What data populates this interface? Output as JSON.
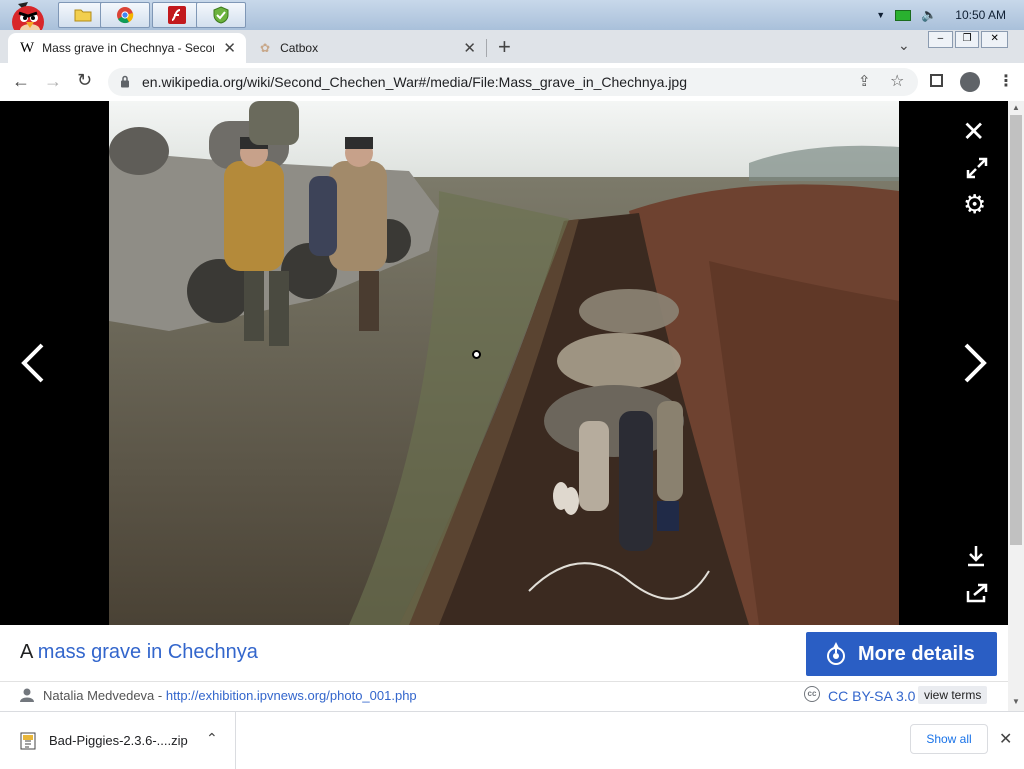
{
  "taskbar": {
    "time": "10:50 AM",
    "apps": [
      "folder-icon",
      "chrome-icon",
      "flash-icon",
      "shield-icon"
    ]
  },
  "browser": {
    "tabs": [
      {
        "label": "Mass grave in Chechnya - Secon",
        "favicon": "W",
        "active": true
      },
      {
        "label": "Catbox",
        "active": false
      }
    ],
    "url": "en.wikipedia.org/wiki/Second_Chechen_War#/media/File:Mass_grave_in_Chechnya.jpg"
  },
  "viewer": {
    "caption_prefix": "A ",
    "caption_link": "mass grave in Chechnya",
    "more_details_label": "More details",
    "author": "Natalia Medvedeva",
    "author_sep": " - ",
    "source_url": "http://exhibition.ipvnews.org/photo_001.php",
    "license": "CC BY-SA 3.0",
    "view_terms": "view terms"
  },
  "downloads": {
    "file_name": "Bad-Piggies-2.3.6-....zip",
    "show_all": "Show all"
  },
  "colors": {
    "accent": "#2a5ec4",
    "link": "#3366cc",
    "viewer_bg": "#000000"
  }
}
